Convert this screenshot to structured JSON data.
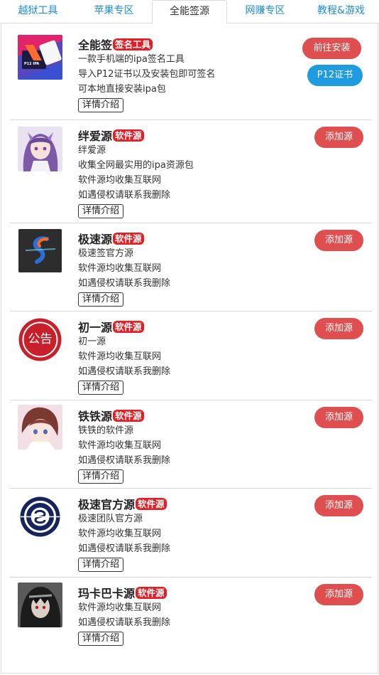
{
  "tabs": [
    {
      "label": "越狱工具",
      "active": false
    },
    {
      "label": "苹果专区",
      "active": false
    },
    {
      "label": "全能签源",
      "active": true
    },
    {
      "label": "网赚专区",
      "active": false
    },
    {
      "label": "教程&游戏",
      "active": false
    }
  ],
  "detail_label": "详情介绍",
  "colors": {
    "accent_blue": "#1a8ed8",
    "tag_red": "#e41e25",
    "button_red": "#e04f4f",
    "button_blue": "#1f9ce0"
  },
  "items": [
    {
      "name": "全能签",
      "tag": "签名工具",
      "lines": [
        "一款手机端的ipa签名工具",
        "导入P12证书以及安装包即可签名",
        "可本地直接安装ipa包"
      ],
      "buttons": [
        "前往安装",
        "P12证书"
      ],
      "icon": "quanneng-app-icon",
      "icon_text": "P12 IPA"
    },
    {
      "name": "绊爱源",
      "tag": "软件源",
      "lines": [
        "绊爱源",
        "收集全网最实用的ipa资源包",
        "软件源均收集互联网",
        "如遇侵权请联系我删除"
      ],
      "buttons": [
        "添加源"
      ],
      "icon": "anime-girl-purple-avatar"
    },
    {
      "name": "极速源",
      "tag": "软件源",
      "lines": [
        "极速签官方源",
        "软件源均收集互联网",
        "如遇侵权请联系我删除"
      ],
      "buttons": [
        "添加源"
      ],
      "icon": "s-logo-icon"
    },
    {
      "name": "初一源",
      "tag": "软件源",
      "lines": [
        "初一源",
        "软件源均收集互联网",
        "如遇侵权请联系我删除"
      ],
      "buttons": [
        "添加源"
      ],
      "icon": "announcement-badge-icon",
      "icon_text": "公告"
    },
    {
      "name": "铁铁源",
      "tag": "软件源",
      "lines": [
        "铁铁的软件源",
        "软件源均收集互联网",
        "如遇侵权请联系我删除"
      ],
      "buttons": [
        "添加源"
      ],
      "icon": "anime-boy-avatar"
    },
    {
      "name": "极速官方源",
      "tag": "软件源",
      "lines": [
        "极速团队官方源",
        "软件源均收集互联网",
        "如遇侵权请联系我删除"
      ],
      "buttons": [
        "添加源"
      ],
      "icon": "round-emblem-logo-icon"
    },
    {
      "name": "玛卡巴卡源",
      "tag": "软件源",
      "lines": [
        "软件源均收集互联网",
        "如遇侵权请联系我删除"
      ],
      "buttons": [
        "添加源"
      ],
      "icon": "dark-anime-avatar"
    }
  ]
}
